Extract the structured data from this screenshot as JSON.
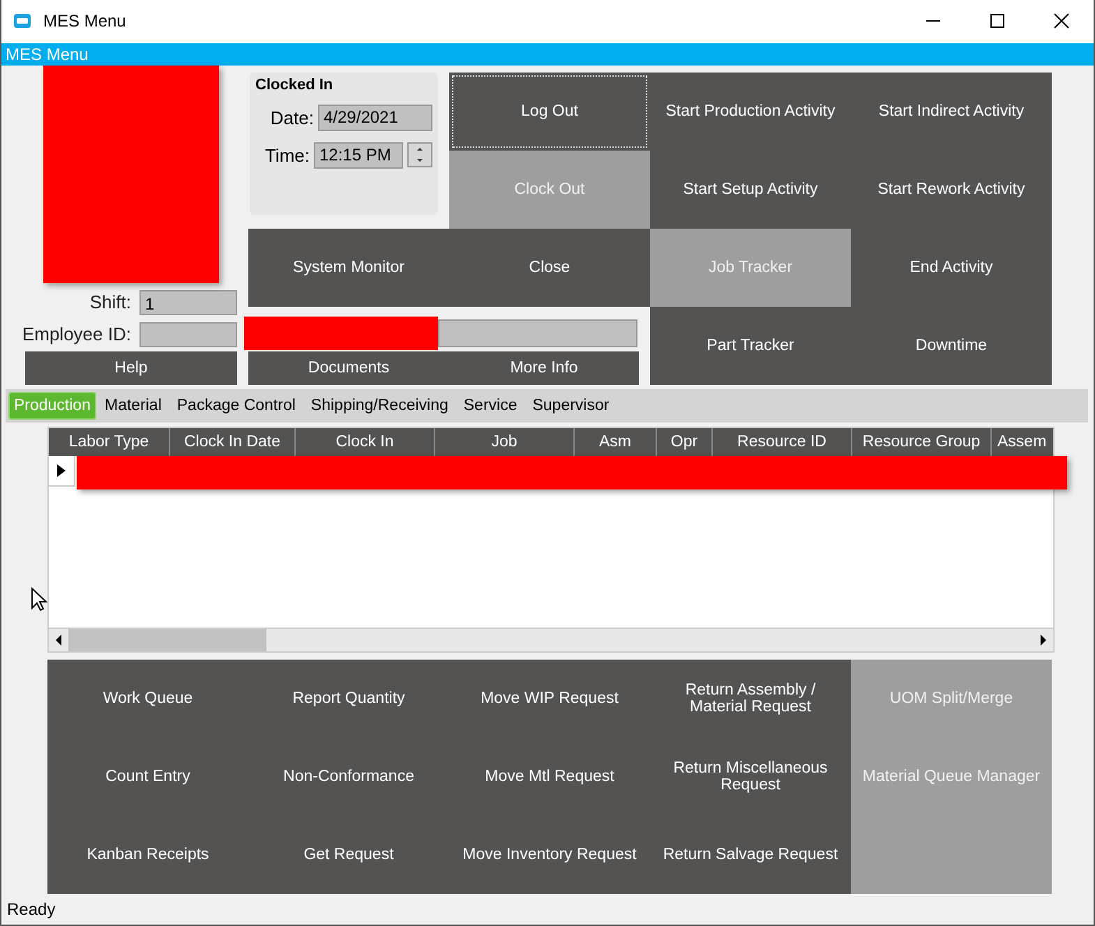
{
  "window": {
    "title": "MES Menu"
  },
  "header_bar": {
    "title": "MES Menu"
  },
  "clock_panel": {
    "heading": "Clocked In",
    "date_label": "Date:",
    "date_value": "4/29/2021",
    "time_label": "Time:",
    "time_value": "12:15 PM"
  },
  "shift": {
    "label": "Shift:",
    "value": "1"
  },
  "employee_id": {
    "label": "Employee ID:"
  },
  "left_buttons": [
    {
      "label": "Help",
      "disabled": false
    }
  ],
  "action_buttons": [
    {
      "label": "Log Out",
      "disabled": false,
      "focused": true
    },
    {
      "label": "Start Production Activity",
      "disabled": false,
      "focused": false
    },
    {
      "label": "Start Indirect Activity",
      "disabled": false,
      "focused": false
    },
    {
      "label": "Clock Out",
      "disabled": true,
      "focused": false
    },
    {
      "label": "Start Setup Activity",
      "disabled": false,
      "focused": false
    },
    {
      "label": "Start Rework Activity",
      "disabled": false,
      "focused": false
    },
    {
      "label": "System Monitor",
      "disabled": false,
      "focused": false
    },
    {
      "label": "Close",
      "disabled": false,
      "focused": false
    },
    {
      "label": "Job Tracker",
      "disabled": true,
      "focused": false
    },
    {
      "label": "End Activity",
      "disabled": false,
      "focused": false
    },
    {
      "label": "Part Tracker",
      "disabled": false,
      "focused": false
    },
    {
      "label": "Downtime",
      "disabled": false,
      "focused": false
    }
  ],
  "info_buttons": [
    {
      "label": "Documents"
    },
    {
      "label": "More Info"
    }
  ],
  "tabs": [
    {
      "label": "Production",
      "selected": true
    },
    {
      "label": "Material",
      "selected": false
    },
    {
      "label": "Package Control",
      "selected": false
    },
    {
      "label": "Shipping/Receiving",
      "selected": false
    },
    {
      "label": "Service",
      "selected": false
    },
    {
      "label": "Supervisor",
      "selected": false
    }
  ],
  "table": {
    "columns": [
      "Labor Type",
      "Clock In Date",
      "Clock In",
      "Job",
      "Asm",
      "Opr",
      "Resource ID",
      "Resource Group",
      "Assem"
    ],
    "rows": [
      {
        "current": true
      }
    ]
  },
  "bottom_buttons": [
    {
      "label": "Work Queue",
      "disabled": false
    },
    {
      "label": "Report Quantity",
      "disabled": false
    },
    {
      "label": "Move WIP Request",
      "disabled": false
    },
    {
      "label": "Return Assembly / Material Request",
      "disabled": false
    },
    {
      "label": "UOM Split/Merge",
      "disabled": true
    },
    {
      "label": "Count Entry",
      "disabled": false
    },
    {
      "label": "Non-Conformance",
      "disabled": false
    },
    {
      "label": "Move Mtl Request",
      "disabled": false
    },
    {
      "label": "Return Miscellaneous Request",
      "disabled": false
    },
    {
      "label": "Material Queue Manager",
      "disabled": true
    },
    {
      "label": "Kanban Receipts",
      "disabled": false
    },
    {
      "label": "Get Request",
      "disabled": false
    },
    {
      "label": "Move Inventory Request",
      "disabled": false
    },
    {
      "label": "Return Salvage Request",
      "disabled": false
    },
    {
      "disabled": true
    }
  ],
  "status_bar": {
    "text": "Ready"
  }
}
